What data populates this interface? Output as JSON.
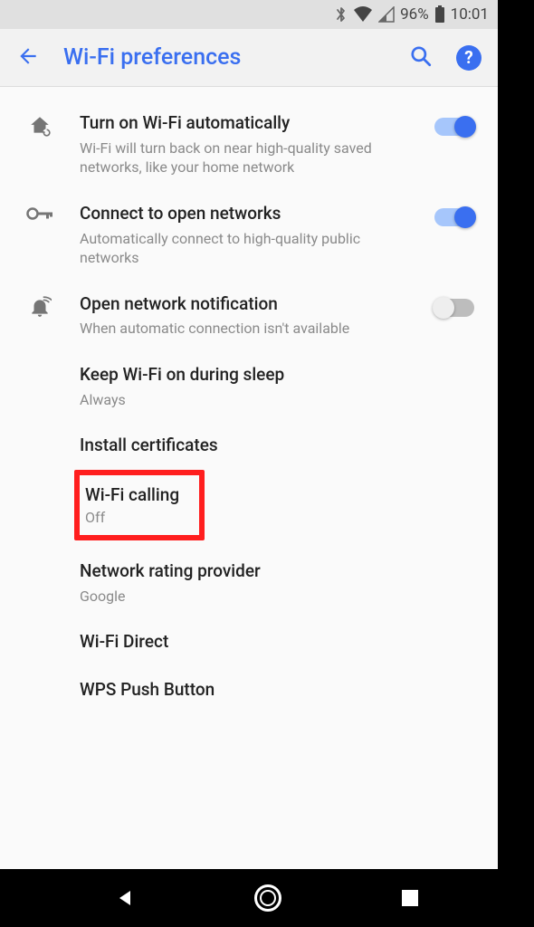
{
  "statusbar": {
    "battery_pct": "96%",
    "time": "10:01"
  },
  "appbar": {
    "title": "Wi-Fi preferences"
  },
  "rows": {
    "auto": {
      "title": "Turn on Wi-Fi automatically",
      "sub": "Wi-Fi will turn back on near high-quality saved networks, like your home network"
    },
    "open": {
      "title": "Connect to open networks",
      "sub": "Automatically connect to high-quality public networks"
    },
    "notif": {
      "title": "Open network notification",
      "sub": "When automatic connection isn't available"
    },
    "sleep": {
      "title": "Keep Wi-Fi on during sleep",
      "sub": "Always"
    },
    "certs": {
      "title": "Install certificates"
    },
    "calling": {
      "title": "Wi-Fi calling",
      "sub": "Off"
    },
    "rating": {
      "title": "Network rating provider",
      "sub": "Google"
    },
    "direct": {
      "title": "Wi-Fi Direct"
    },
    "wps": {
      "title": "WPS Push Button"
    }
  }
}
